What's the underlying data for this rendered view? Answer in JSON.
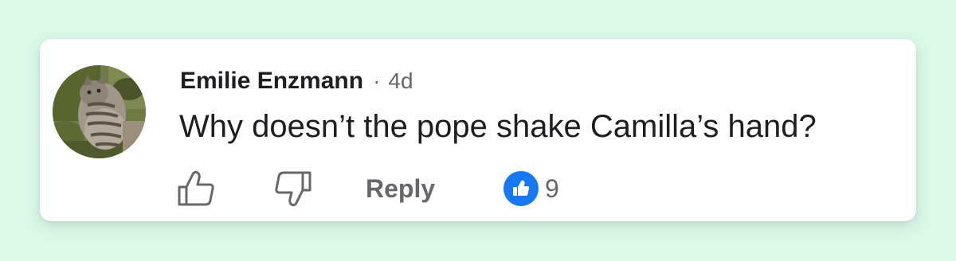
{
  "comment": {
    "author": "Emilie Enzmann",
    "separator": "·",
    "age": "4d",
    "text": "Why doesn’t the pope shake Camilla’s hand?",
    "avatar_icon": "cat-photo-avatar"
  },
  "actions": {
    "like_icon": "thumbs-up-outline-icon",
    "dislike_icon": "thumbs-down-outline-icon",
    "reply_label": "Reply",
    "reaction_icon": "like-reaction-icon",
    "reaction_count": "9"
  },
  "colors": {
    "page_background": "#dcf9e8",
    "card_background": "#ffffff",
    "primary_text": "#1c1e21",
    "secondary_text": "#65676b",
    "like_blue": "#1877f2"
  }
}
